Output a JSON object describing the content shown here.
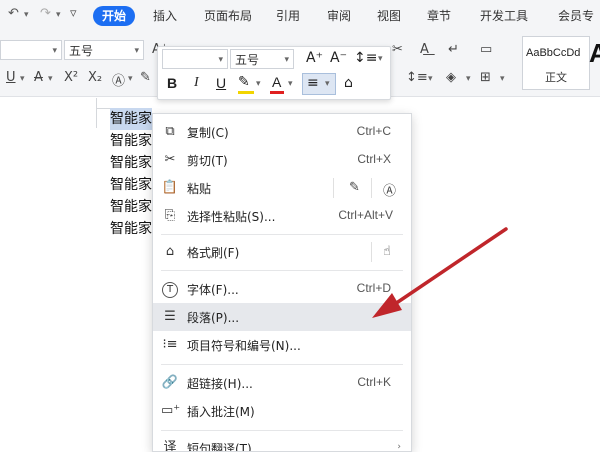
{
  "quick_access": {
    "undo": "↶",
    "redo": "↷",
    "more": "▿"
  },
  "tabs": [
    {
      "label": "开始",
      "active": true
    },
    {
      "label": "插入"
    },
    {
      "label": "页面布局"
    },
    {
      "label": "引用"
    },
    {
      "label": "审阅"
    },
    {
      "label": "视图"
    },
    {
      "label": "章节"
    },
    {
      "label": "开发工具"
    },
    {
      "label": "会员专"
    }
  ],
  "ribbon": {
    "font_size": "五号",
    "style_sample": "AaBbCcDd",
    "style_name": "正文",
    "style_big": "A"
  },
  "mini_toolbar": {
    "font_name": "",
    "font_size": "五号",
    "bold": "B",
    "italic": "I",
    "underline": "U",
    "font_color": "A"
  },
  "document": {
    "lines": [
      "智能家",
      "智能家",
      "智能家",
      "智能家",
      "智能家",
      "智能家"
    ],
    "first_line_selected_tail": "智能家"
  },
  "context_menu": {
    "items": [
      {
        "label": "复制(C)",
        "shortcut": "Ctrl+C",
        "icon": "copy-icon"
      },
      {
        "label": "剪切(T)",
        "shortcut": "Ctrl+X",
        "icon": "cut-icon"
      },
      {
        "label": "粘贴",
        "shortcut": "",
        "icon": "paste-icon"
      },
      {
        "label": "选择性粘贴(S)...",
        "shortcut": "Ctrl+Alt+V",
        "icon": "paste-special-icon"
      },
      {
        "label": "格式刷(F)",
        "shortcut": "",
        "icon": "format-painter-icon"
      },
      {
        "label": "字体(F)...",
        "shortcut": "Ctrl+D",
        "icon": "font-icon"
      },
      {
        "label": "段落(P)...",
        "shortcut": "",
        "icon": "paragraph-icon"
      },
      {
        "label": "项目符号和编号(N)...",
        "shortcut": "",
        "icon": "bullets-icon"
      },
      {
        "label": "超链接(H)...",
        "shortcut": "Ctrl+K",
        "icon": "hyperlink-icon"
      },
      {
        "label": "插入批注(M)",
        "shortcut": "",
        "icon": "comment-icon"
      },
      {
        "label": "短句翻译(T)",
        "shortcut": "",
        "icon": "translate-icon"
      }
    ]
  },
  "colors": {
    "accent": "#1c6ef2",
    "arrow": "#c0262b",
    "hover": "#e6e8ec"
  }
}
